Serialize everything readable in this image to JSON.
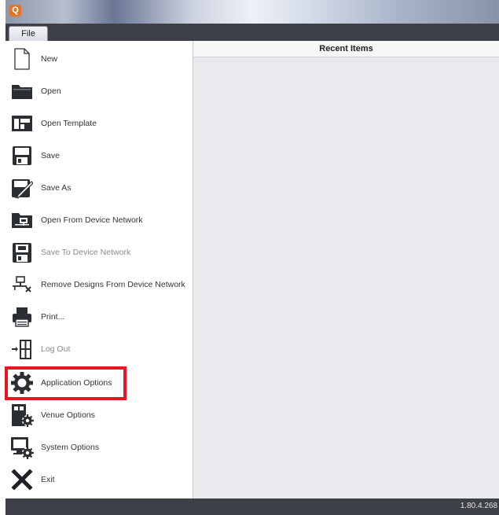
{
  "app": {
    "icon_glyph": "Q"
  },
  "menubar": {
    "file_tab": "File"
  },
  "menu_items": [
    {
      "label": "New",
      "icon": "new-document-icon",
      "disabled": false
    },
    {
      "label": "Open",
      "icon": "folder-open-icon",
      "disabled": false
    },
    {
      "label": "Open Template",
      "icon": "open-template-icon",
      "disabled": false
    },
    {
      "label": "Save",
      "icon": "floppy-save-icon",
      "disabled": false
    },
    {
      "label": "Save As",
      "icon": "floppy-save-as-icon",
      "disabled": false
    },
    {
      "label": "Open From Device Network",
      "icon": "open-network-icon",
      "disabled": false
    },
    {
      "label": "Save To Device Network",
      "icon": "save-network-icon",
      "disabled": true
    },
    {
      "label": "Remove Designs From Device Network",
      "icon": "remove-network-icon",
      "disabled": false
    },
    {
      "label": "Print...",
      "icon": "printer-icon",
      "disabled": false
    },
    {
      "label": "Log Out",
      "icon": "logout-icon",
      "disabled": true
    },
    {
      "label": "Application Options",
      "icon": "gear-icon",
      "disabled": false
    },
    {
      "label": "Venue Options",
      "icon": "venue-options-icon",
      "disabled": false
    },
    {
      "label": "System Options",
      "icon": "system-options-icon",
      "disabled": false
    },
    {
      "label": "Exit",
      "icon": "exit-x-icon",
      "disabled": false
    }
  ],
  "main": {
    "recent_header": "Recent Items"
  },
  "statusbar": {
    "version": "1.80.4.268"
  },
  "colors": {
    "highlight": "#e8141e",
    "chrome_dark": "#3d4147",
    "icon_dark": "#2b2f34"
  }
}
